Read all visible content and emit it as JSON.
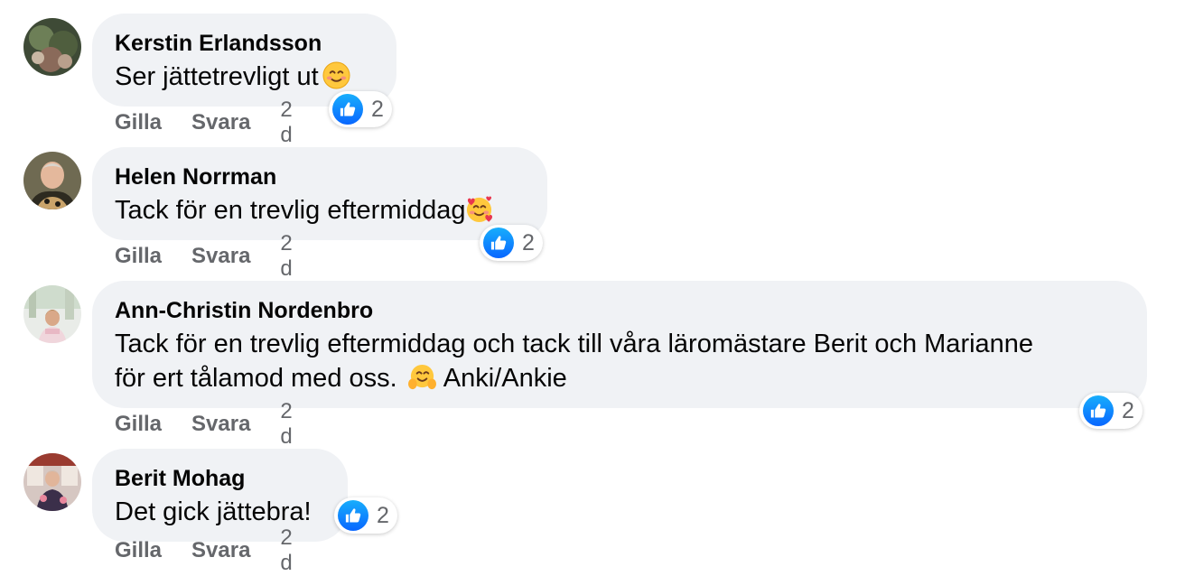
{
  "comments": [
    {
      "author": "Kerstin Erlandsson",
      "text": "Ser jättetrevligt ut",
      "emoji": "smiling-face-icon",
      "reactions": {
        "icon": "like-icon",
        "count": "2"
      },
      "actions": {
        "like": "Gilla",
        "reply": "Svara",
        "time": "2 d"
      }
    },
    {
      "author": "Helen Norrman",
      "text": "Tack för en trevlig eftermiddag",
      "emoji": "smiling-face-with-hearts-icon",
      "reactions": {
        "icon": "like-icon",
        "count": "2"
      },
      "actions": {
        "like": "Gilla",
        "reply": "Svara",
        "time": "2 d"
      }
    },
    {
      "author": "Ann-Christin Nordenbro",
      "text_line1": "Tack för en trevlig eftermiddag och tack till våra läromästare Berit och Marianne",
      "text_line2_a": "för ert tålamod med oss.",
      "text_line2_b": "Anki/Ankie",
      "emoji": "hugging-face-icon",
      "reactions": {
        "icon": "like-icon",
        "count": "2"
      },
      "actions": {
        "like": "Gilla",
        "reply": "Svara",
        "time": "2 d"
      }
    },
    {
      "author": "Berit Mohag",
      "text": "Det gick jättebra!",
      "reactions": {
        "icon": "like-icon",
        "count": "2"
      },
      "actions": {
        "like": "Gilla",
        "reply": "Svara",
        "time": "2 d"
      }
    }
  ],
  "colors": {
    "bubble": "#f0f2f5",
    "meta_text": "#65676b",
    "like_blue": "#0866ff"
  }
}
